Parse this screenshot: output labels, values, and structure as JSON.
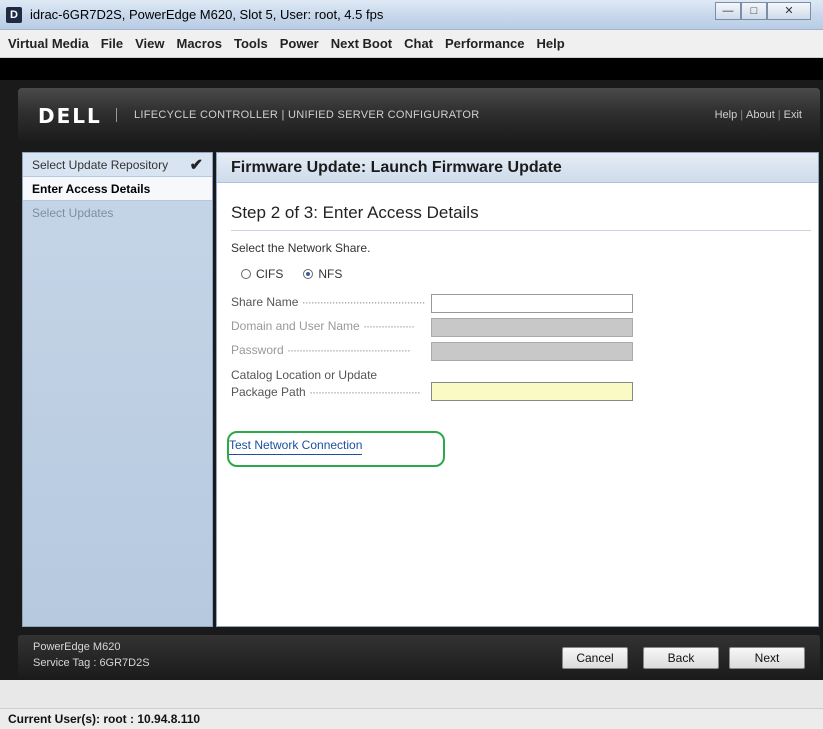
{
  "window": {
    "app_icon": "D",
    "title": "idrac-6GR7D2S, PowerEdge M620,  Slot 5, User: root, 4.5 fps",
    "minimize_icon": "minimize-icon",
    "maximize_icon": "maximize-icon",
    "close_icon": "close-icon"
  },
  "menubar": {
    "items": [
      "Virtual Media",
      "File",
      "View",
      "Macros",
      "Tools",
      "Power",
      "Next Boot",
      "Chat",
      "Performance",
      "Help"
    ]
  },
  "header": {
    "logo": "DELL",
    "title": "LIFECYCLE CONTROLLER  |  UNIFIED SERVER CONFIGURATOR",
    "links": [
      "Help",
      "About",
      "Exit"
    ]
  },
  "sidebar": {
    "items": [
      {
        "label": "Select Update Repository",
        "state": "done"
      },
      {
        "label": "Enter Access Details",
        "state": "current"
      },
      {
        "label": "Select Updates",
        "state": "pending"
      }
    ],
    "check_icon": "check-icon"
  },
  "main": {
    "title": "Firmware Update: Launch Firmware Update",
    "step": "Step 2 of 3: Enter  Access Details",
    "prompt": "Select the Network Share.",
    "share_options": [
      {
        "label": "CIFS",
        "selected": false
      },
      {
        "label": "NFS",
        "selected": true
      }
    ],
    "fields": {
      "share_name": {
        "label": "Share Name",
        "value": ""
      },
      "domain_user": {
        "label": "Domain and User Name",
        "value": ""
      },
      "password": {
        "label": "Password",
        "value": ""
      },
      "catalog_line1": "Catalog Location or Update",
      "catalog_line2": "Package Path",
      "catalog_value": ""
    },
    "test_link": "Test Network Connection"
  },
  "footer": {
    "model": "PowerEdge M620",
    "service_tag": "Service Tag : 6GR7D2S",
    "cancel": "Cancel",
    "back": "Back",
    "next": "Next"
  },
  "status": {
    "text": "Current User(s): root : 10.94.8.110"
  },
  "colors": {
    "sidebar_bg": "#c6d6e8",
    "active_input": "#fafbc4",
    "highlight_circle": "#2aa84a",
    "link": "#1e4fa0"
  }
}
